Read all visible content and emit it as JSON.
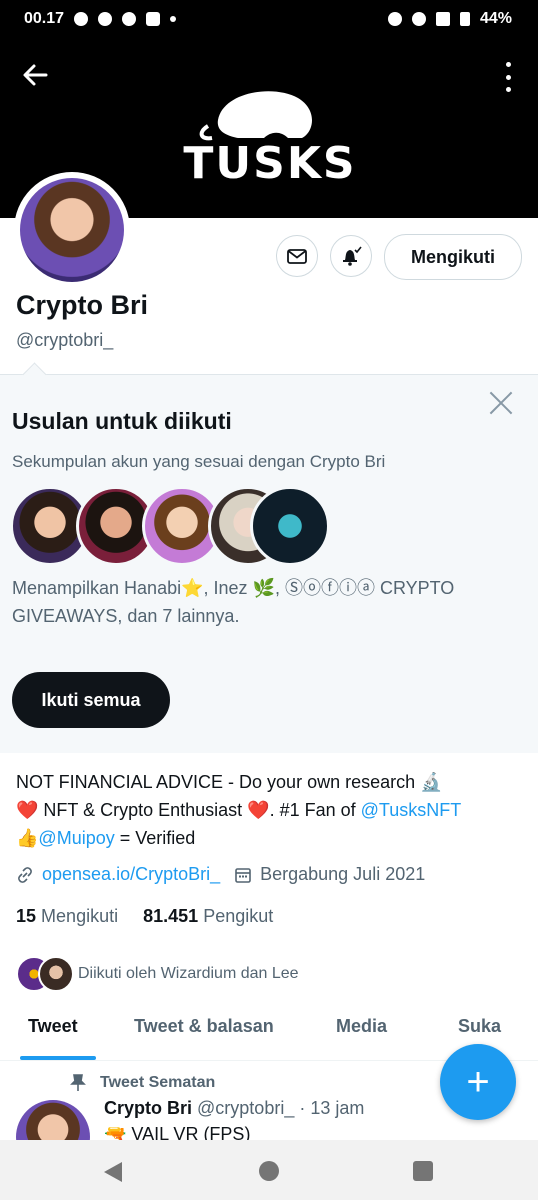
{
  "status_bar": {
    "time": "00.17",
    "battery": "44%"
  },
  "header": {
    "back_icon": "arrow-left-icon",
    "more_icon": "more-vertical-icon",
    "banner_logo_text": "TUSKS"
  },
  "profile": {
    "name": "Crypto Bri",
    "handle": "@cryptobri_",
    "follow_button_label": "Mengikuti",
    "message_icon": "mail-icon",
    "notify_icon": "bell-icon"
  },
  "suggestions": {
    "title": "Usulan untuk diikuti",
    "subtitle": "Sekumpulan akun yang sesuai dengan Crypto Bri",
    "description": "Menampilkan Hanabi⭐, Inez 🌿, Ⓢⓞⓕⓘⓐ CRYPTO GIVEAWAYS, dan 7 lainnya.",
    "follow_all_label": "Ikuti semua",
    "avatar_colors": [
      "#3b2a5a",
      "#7a1f3a",
      "#c47bd6",
      "#e8e0dc",
      "#0e1e2a"
    ]
  },
  "bio": {
    "line1": "NOT FINANCIAL ADVICE - Do your own research 🔬",
    "heart": "❤️",
    "line2_text": " NFT & Crypto Enthusiast ",
    "line2_suffix": ". #1 Fan of ",
    "mention_tusks": "@TusksNFT",
    "thumbs": "👍",
    "mention_muipoy": "@Muipoy",
    "verified_text": " = Verified"
  },
  "meta": {
    "link": "opensea.io/CryptoBri_",
    "joined": "Bergabung Juli 2021"
  },
  "stats": {
    "following_count": "15",
    "following_label": "Mengikuti",
    "followers_count": "81.451",
    "followers_label": "Pengikut"
  },
  "followed_by": "Diikuti oleh Wizardium dan Lee",
  "tabs": [
    "Tweet",
    "Tweet & balasan",
    "Media",
    "Suka"
  ],
  "pinned_tweet": {
    "label": "Tweet Sematan",
    "author": "Crypto Bri",
    "handle_time": "@cryptobri_ · 13 jam",
    "text": "🔫 VAIL VR (FPS)"
  },
  "fab_label": "+",
  "colors": {
    "accent": "#1d9bf0",
    "text": "#0f1419",
    "muted": "#536471"
  }
}
